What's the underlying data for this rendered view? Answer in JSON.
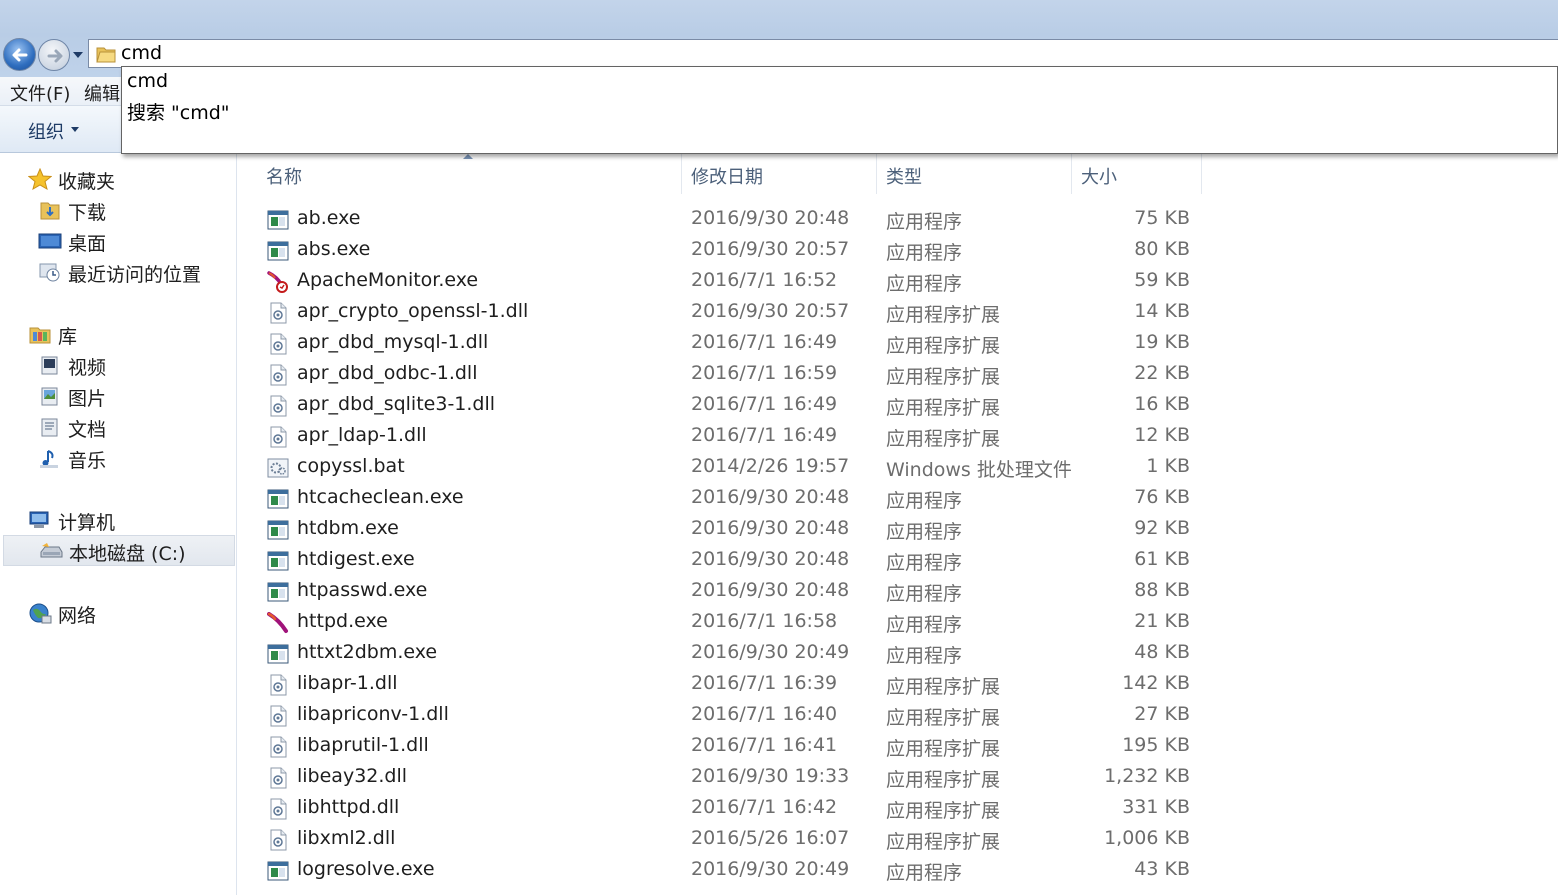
{
  "address": {
    "value": "cmd"
  },
  "suggestions": [
    "cmd",
    "搜索 \"cmd\""
  ],
  "menu": {
    "file": "文件(F)",
    "edit": "编辑"
  },
  "toolbar": {
    "organize": "组织"
  },
  "sidebar": {
    "favorites": {
      "label": "收藏夹",
      "items": [
        "下载",
        "桌面",
        "最近访问的位置"
      ]
    },
    "libraries": {
      "label": "库",
      "items": [
        "视频",
        "图片",
        "文档",
        "音乐"
      ]
    },
    "computer": {
      "label": "计算机",
      "items": [
        "本地磁盘 (C:)"
      ]
    },
    "network": {
      "label": "网络"
    }
  },
  "columns": {
    "name": "名称",
    "date": "修改日期",
    "type": "类型",
    "size": "大小"
  },
  "files": [
    {
      "name": "ab.exe",
      "date": "2016/9/30 20:48",
      "type": "应用程序",
      "size": "75 KB",
      "icon": "exe"
    },
    {
      "name": "abs.exe",
      "date": "2016/9/30 20:57",
      "type": "应用程序",
      "size": "80 KB",
      "icon": "exe"
    },
    {
      "name": "ApacheMonitor.exe",
      "date": "2016/7/1 16:52",
      "type": "应用程序",
      "size": "59 KB",
      "icon": "apache-monitor"
    },
    {
      "name": "apr_crypto_openssl-1.dll",
      "date": "2016/9/30 20:57",
      "type": "应用程序扩展",
      "size": "14 KB",
      "icon": "dll"
    },
    {
      "name": "apr_dbd_mysql-1.dll",
      "date": "2016/7/1 16:49",
      "type": "应用程序扩展",
      "size": "19 KB",
      "icon": "dll"
    },
    {
      "name": "apr_dbd_odbc-1.dll",
      "date": "2016/7/1 16:59",
      "type": "应用程序扩展",
      "size": "22 KB",
      "icon": "dll"
    },
    {
      "name": "apr_dbd_sqlite3-1.dll",
      "date": "2016/7/1 16:49",
      "type": "应用程序扩展",
      "size": "16 KB",
      "icon": "dll"
    },
    {
      "name": "apr_ldap-1.dll",
      "date": "2016/7/1 16:49",
      "type": "应用程序扩展",
      "size": "12 KB",
      "icon": "dll"
    },
    {
      "name": "copyssl.bat",
      "date": "2014/2/26 19:57",
      "type": "Windows 批处理文件",
      "size": "1 KB",
      "icon": "bat"
    },
    {
      "name": "htcacheclean.exe",
      "date": "2016/9/30 20:48",
      "type": "应用程序",
      "size": "76 KB",
      "icon": "exe"
    },
    {
      "name": "htdbm.exe",
      "date": "2016/9/30 20:48",
      "type": "应用程序",
      "size": "92 KB",
      "icon": "exe"
    },
    {
      "name": "htdigest.exe",
      "date": "2016/9/30 20:48",
      "type": "应用程序",
      "size": "61 KB",
      "icon": "exe"
    },
    {
      "name": "htpasswd.exe",
      "date": "2016/9/30 20:48",
      "type": "应用程序",
      "size": "88 KB",
      "icon": "exe"
    },
    {
      "name": "httpd.exe",
      "date": "2016/7/1 16:58",
      "type": "应用程序",
      "size": "21 KB",
      "icon": "apache-feather"
    },
    {
      "name": "httxt2dbm.exe",
      "date": "2016/9/30 20:49",
      "type": "应用程序",
      "size": "48 KB",
      "icon": "exe"
    },
    {
      "name": "libapr-1.dll",
      "date": "2016/7/1 16:39",
      "type": "应用程序扩展",
      "size": "142 KB",
      "icon": "dll"
    },
    {
      "name": "libapriconv-1.dll",
      "date": "2016/7/1 16:40",
      "type": "应用程序扩展",
      "size": "27 KB",
      "icon": "dll"
    },
    {
      "name": "libaprutil-1.dll",
      "date": "2016/7/1 16:41",
      "type": "应用程序扩展",
      "size": "195 KB",
      "icon": "dll"
    },
    {
      "name": "libeay32.dll",
      "date": "2016/9/30 19:33",
      "type": "应用程序扩展",
      "size": "1,232 KB",
      "icon": "dll"
    },
    {
      "name": "libhttpd.dll",
      "date": "2016/7/1 16:42",
      "type": "应用程序扩展",
      "size": "331 KB",
      "icon": "dll"
    },
    {
      "name": "libxml2.dll",
      "date": "2016/5/26 16:07",
      "type": "应用程序扩展",
      "size": "1,006 KB",
      "icon": "dll"
    },
    {
      "name": "logresolve.exe",
      "date": "2016/9/30 20:49",
      "type": "应用程序",
      "size": "43 KB",
      "icon": "exe"
    }
  ]
}
